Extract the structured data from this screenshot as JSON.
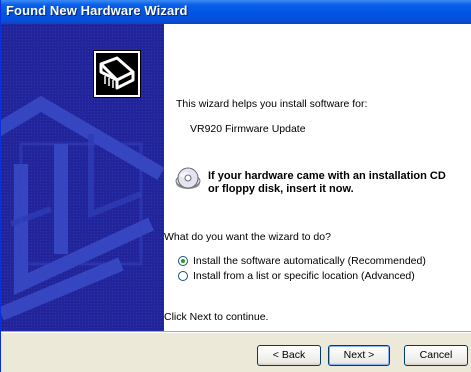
{
  "window": {
    "title": "Found New Hardware Wizard"
  },
  "content": {
    "intro": "This wizard helps you install software for:",
    "device_name": "VR920 Firmware Update",
    "cd_notice_line1": "If your hardware came with an installation CD",
    "cd_notice_line2": "or floppy disk, insert it now.",
    "question": "What do you want the wizard to do?",
    "options": [
      {
        "label": "Install the software automatically (Recommended)",
        "selected": true
      },
      {
        "label": "Install from a list or specific location (Advanced)",
        "selected": false
      }
    ],
    "footer_text": "Click Next to continue."
  },
  "buttons": {
    "back": "< Back",
    "next": "Next >",
    "cancel": "Cancel"
  },
  "icons": {
    "wizard_icon": "hardware-card-icon",
    "cd_icon": "cd-disc-icon"
  },
  "colors": {
    "title_bar": "#0054e3",
    "side_panel": "#22249a",
    "dialog_bg": "#ece9d8"
  }
}
